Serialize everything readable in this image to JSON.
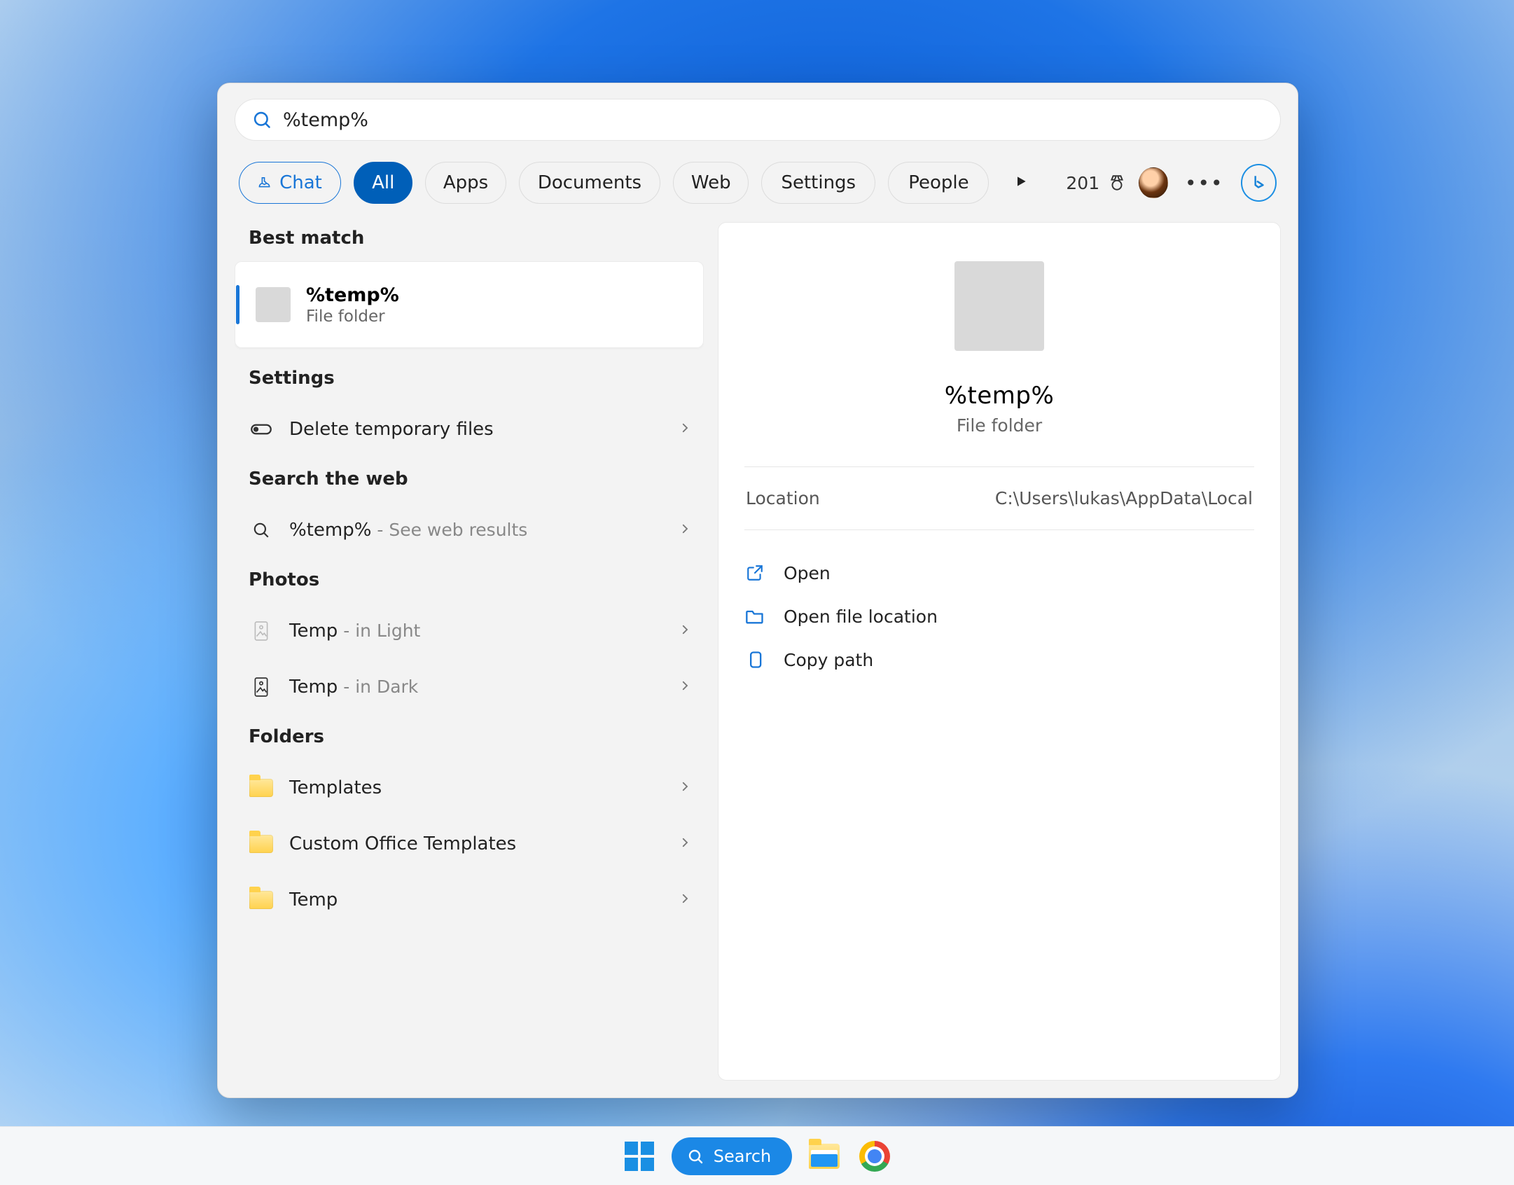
{
  "search": {
    "value": "%temp%"
  },
  "filters": {
    "chat": "Chat",
    "all": "All",
    "apps": "Apps",
    "documents": "Documents",
    "web": "Web",
    "settings": "Settings",
    "people": "People"
  },
  "rewards": {
    "points": "201"
  },
  "sections": {
    "best_match": "Best match",
    "settings": "Settings",
    "search_web": "Search the web",
    "photos": "Photos",
    "folders": "Folders"
  },
  "best": {
    "title": "%temp%",
    "type": "File folder"
  },
  "settings_items": {
    "delete_temp": "Delete temporary files"
  },
  "web": {
    "query": "%temp%",
    "suffix": " - See web results"
  },
  "photos": {
    "item1": {
      "name": "Temp",
      "suffix": " - in Light"
    },
    "item2": {
      "name": "Temp",
      "suffix": " - in Dark"
    }
  },
  "folders": {
    "f1": "Templates",
    "f2": "Custom Office Templates",
    "f3": "Temp"
  },
  "preview": {
    "title": "%temp%",
    "type": "File folder",
    "location_label": "Location",
    "location_value": "C:\\Users\\lukas\\AppData\\Local",
    "open": "Open",
    "open_loc": "Open file location",
    "copy": "Copy path"
  },
  "taskbar": {
    "search": "Search"
  }
}
